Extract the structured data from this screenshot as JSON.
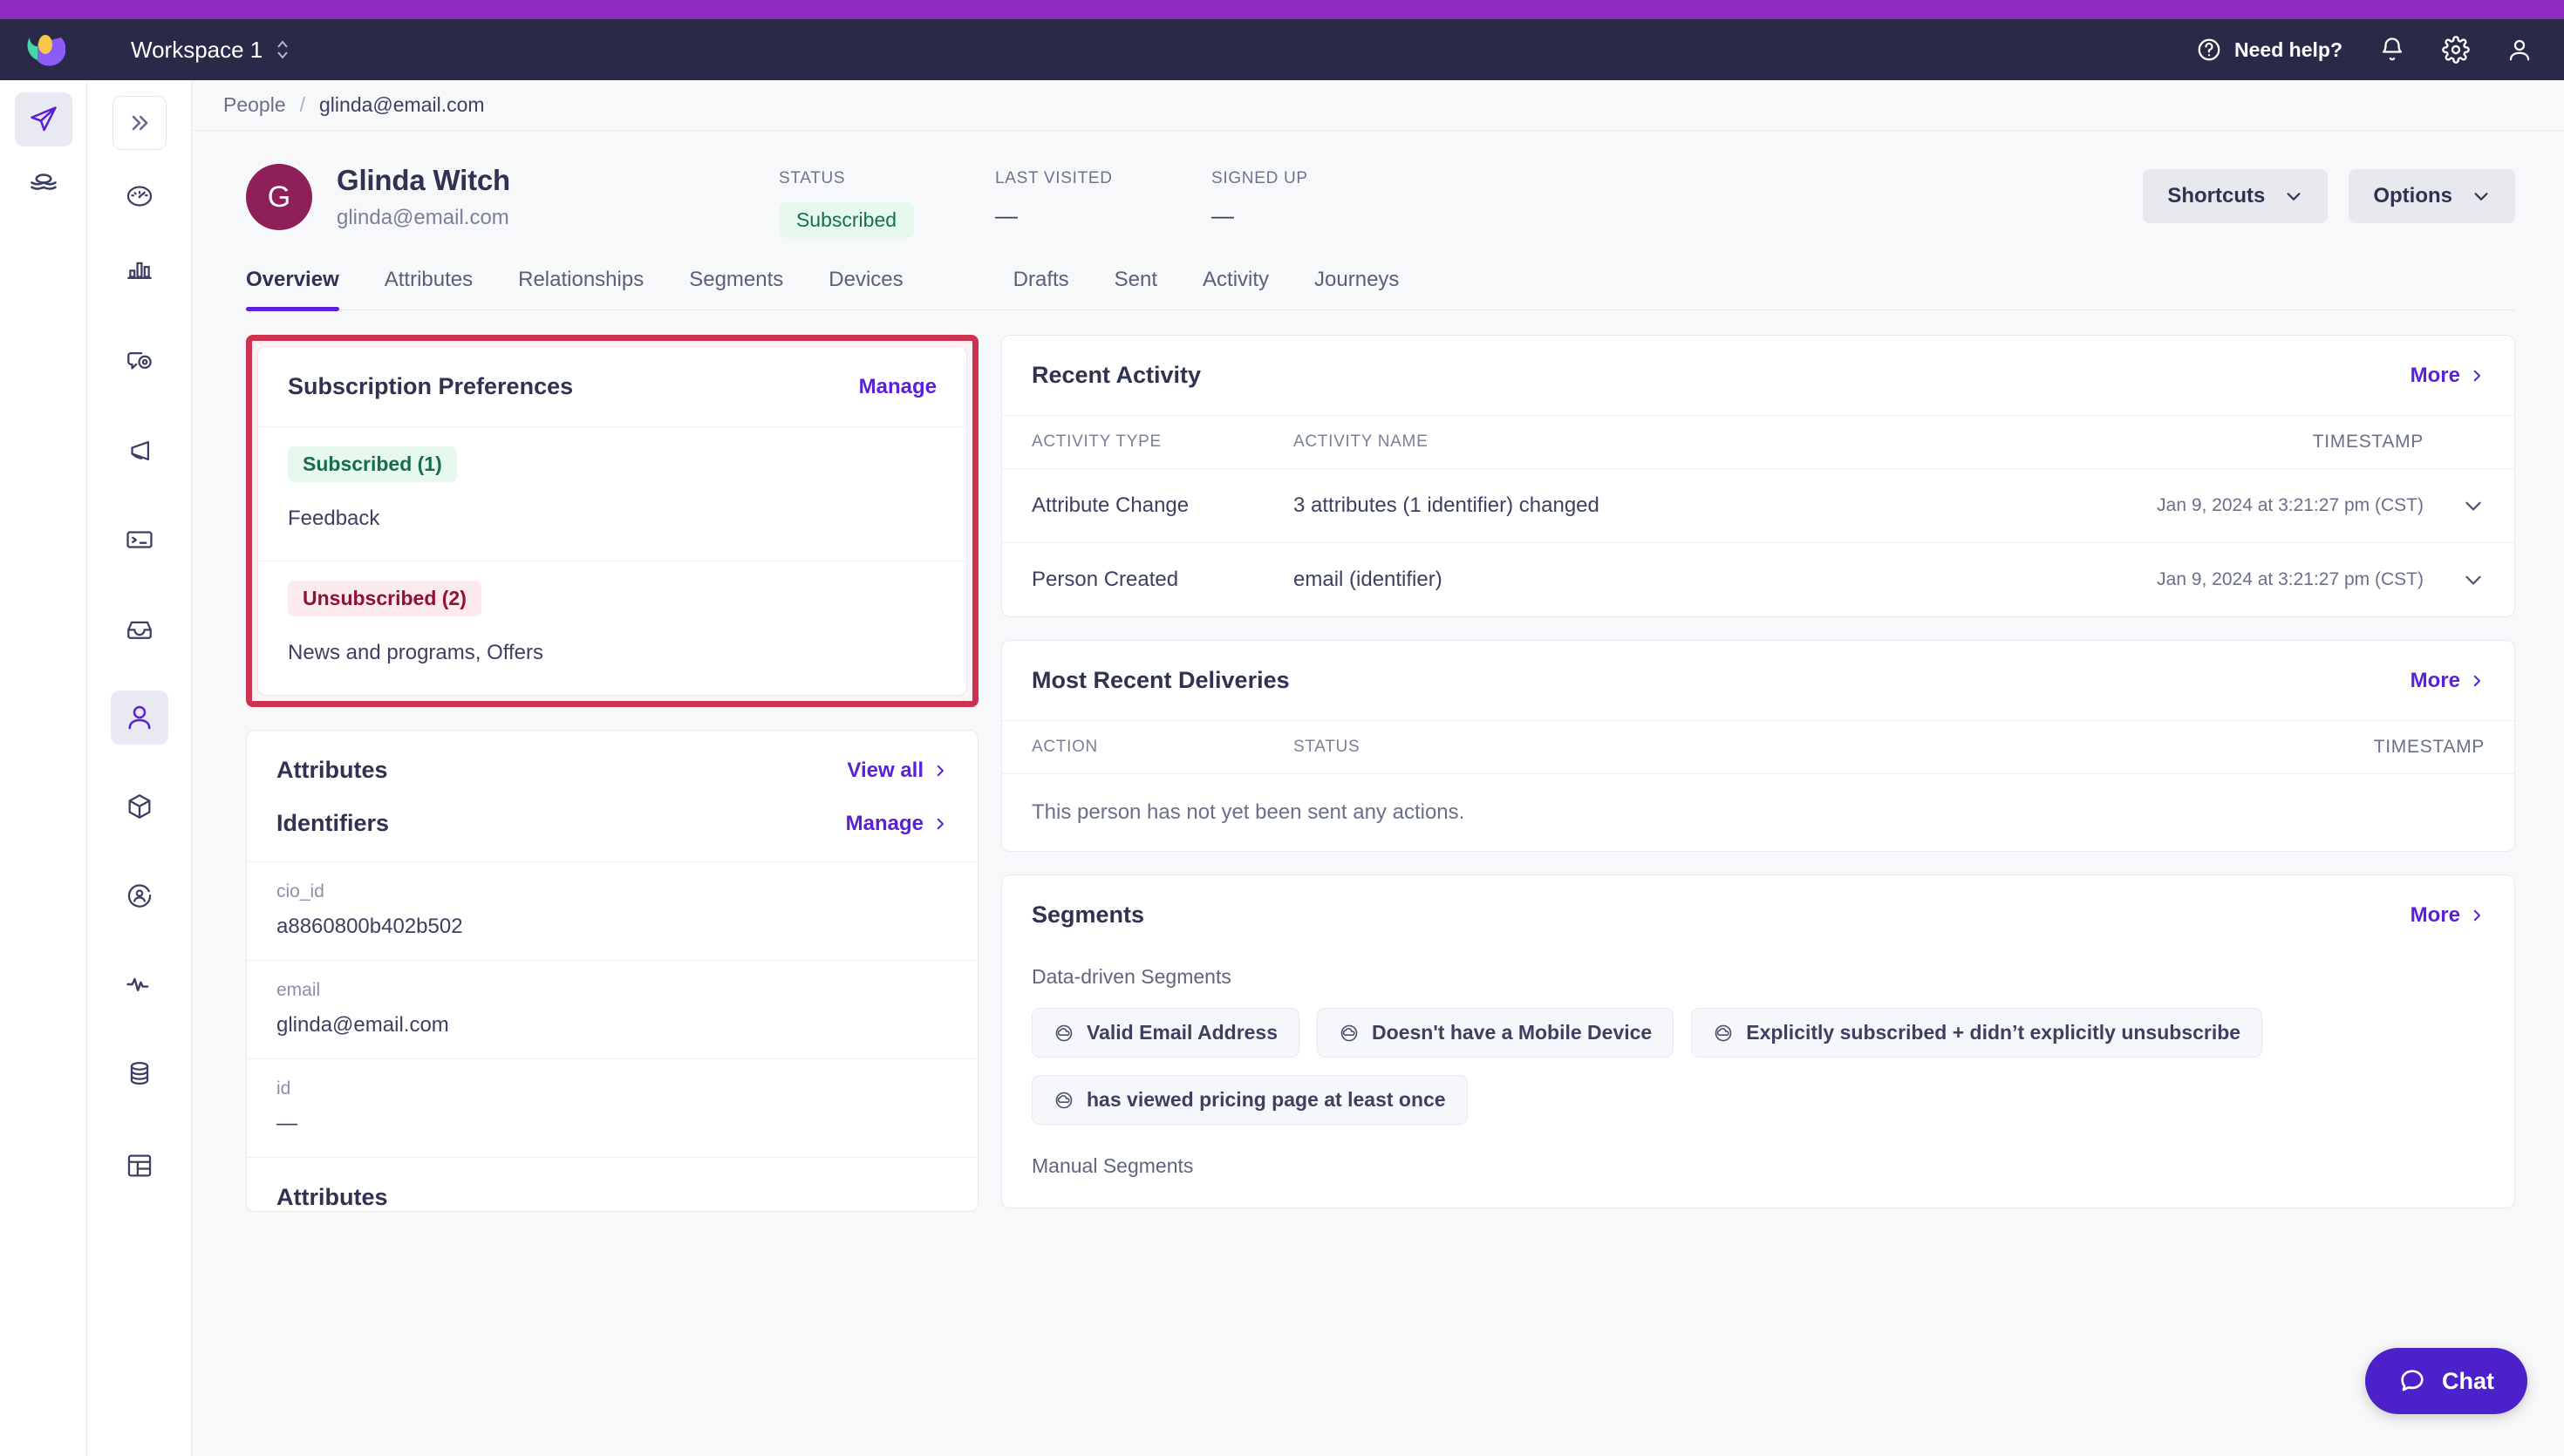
{
  "topbar": {
    "workspace": "Workspace 1",
    "need_help": "Need help?",
    "icons": [
      "help-circle-icon",
      "bell-icon",
      "gear-icon",
      "user-icon"
    ]
  },
  "breadcrumb": {
    "root": "People",
    "separator": "/",
    "current": "glinda@email.com"
  },
  "person": {
    "initial": "G",
    "name": "Glinda Witch",
    "email": "glinda@email.com",
    "meta": [
      {
        "label": "STATUS",
        "value": "Subscribed",
        "type": "pill"
      },
      {
        "label": "LAST VISITED",
        "value": "—",
        "type": "text"
      },
      {
        "label": "SIGNED UP",
        "value": "—",
        "type": "text"
      }
    ],
    "actions": [
      {
        "label": "Shortcuts"
      },
      {
        "label": "Options"
      }
    ]
  },
  "tabs": [
    {
      "label": "Overview",
      "active": true
    },
    {
      "label": "Attributes",
      "active": false
    },
    {
      "label": "Relationships",
      "active": false
    },
    {
      "label": "Segments",
      "active": false
    },
    {
      "label": "Devices",
      "active": false
    },
    {
      "label": "Drafts",
      "active": false,
      "gap": true
    },
    {
      "label": "Sent",
      "active": false
    },
    {
      "label": "Activity",
      "active": false
    },
    {
      "label": "Journeys",
      "active": false
    }
  ],
  "subscription_preferences": {
    "title": "Subscription Preferences",
    "manage_label": "Manage",
    "groups": [
      {
        "badge": "Subscribed (1)",
        "items": "Feedback",
        "style": "green"
      },
      {
        "badge": "Unsubscribed (2)",
        "items": "News and programs, Offers",
        "style": "pink"
      }
    ]
  },
  "attributes_card": {
    "title": "Attributes",
    "view_all_label": "View all",
    "identifiers_title": "Identifiers",
    "identifiers_manage_label": "Manage",
    "identifiers": [
      {
        "key": "cio_id",
        "value": "a8860800b402b502"
      },
      {
        "key": "email",
        "value": "glinda@email.com"
      },
      {
        "key": "id",
        "value": "—"
      }
    ],
    "section_title": "Attributes"
  },
  "recent_activity": {
    "title": "Recent Activity",
    "more_label": "More",
    "columns": [
      "ACTIVITY TYPE",
      "ACTIVITY NAME",
      "TIMESTAMP"
    ],
    "rows": [
      {
        "type": "Attribute Change",
        "name": "3 attributes (1 identifier) changed",
        "timestamp": "Jan 9, 2024 at 3:21:27 pm (CST)"
      },
      {
        "type": "Person Created",
        "name": "email (identifier)",
        "timestamp": "Jan 9, 2024 at 3:21:27 pm (CST)"
      }
    ]
  },
  "recent_deliveries": {
    "title": "Most Recent Deliveries",
    "more_label": "More",
    "columns": [
      "ACTION",
      "STATUS",
      "TIMESTAMP"
    ],
    "empty_message": "This person has not yet been sent any actions."
  },
  "segments": {
    "title": "Segments",
    "more_label": "More",
    "data_driven_label": "Data-driven Segments",
    "data_driven": [
      "Valid Email Address",
      "Doesn't have a Mobile Device",
      "Explicitly subscribed + didn’t explicitly unsubscribe",
      "has viewed pricing page at least once"
    ],
    "manual_label": "Manual Segments"
  },
  "chat": {
    "label": "Chat"
  },
  "colors": {
    "brand_purple": "#5b21d8",
    "topbar_navy": "#282a48",
    "strip_purple": "#8c2bbd",
    "highlight_red": "#cd3250",
    "avatar_maroon": "#8e1f58",
    "subscribed_green_bg": "#e7f8ee",
    "subscribed_green_fg": "#176e4a",
    "unsubscribed_pink_bg": "#fdeaee",
    "unsubscribed_pink_fg": "#8e1233"
  }
}
